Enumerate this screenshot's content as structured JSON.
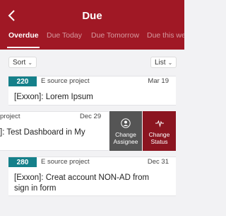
{
  "header": {
    "title": "Due",
    "tabs": [
      "Overdue",
      "Due Today",
      "Due Tomorrow",
      "Due this we"
    ]
  },
  "toolbar": {
    "sort_label": "Sort",
    "view_label": "List"
  },
  "cards": [
    {
      "id": "220",
      "project": "E source project",
      "date": "Mar 19",
      "title": "[Exxon]: Lorem Ipsum"
    },
    {
      "project": "project",
      "date": "Dec 29",
      "title": "]: Test Dashboard in My"
    },
    {
      "id": "280",
      "project": "E source project",
      "date": "Dec 31",
      "title_line1": "[Exxon]: Creat account NON-AD from",
      "title_line2": "sign in form"
    }
  ],
  "actions": {
    "change_assignee_line1": "Change",
    "change_assignee_line2": "Assignee",
    "change_status_line1": "Change",
    "change_status_line2": "Status"
  },
  "colors": {
    "header": "#a01825",
    "badge": "#15808a",
    "action_assignee": "#555555",
    "action_status": "#8b1520"
  },
  "icons": [
    "back-chevron-icon",
    "user-circle-icon",
    "pulse-icon",
    "chevron-down-icon"
  ]
}
